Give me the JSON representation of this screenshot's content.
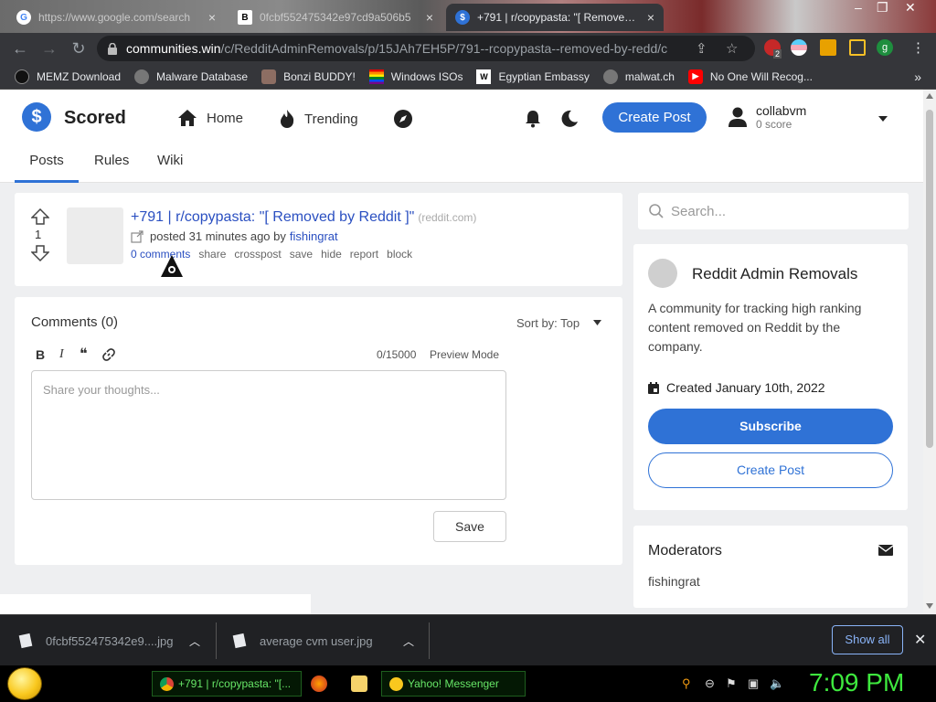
{
  "browser": {
    "tabs": [
      {
        "title": "https://www.google.com/search",
        "active": false
      },
      {
        "title": "0fcbf552475342e97cd9a506b5",
        "active": false
      },
      {
        "title": "+791 | r/copypasta: \"[ Removed by Reddit ]\"",
        "active": true
      }
    ],
    "url_host": "communities.win",
    "url_path": "/c/RedditAdminRemovals/p/15JAh7EH5P/791--rcopypasta--removed-by-redd/c",
    "extension_badge": "2",
    "profile_initial": "g",
    "bookmarks": [
      "MEMZ Download",
      "Malware Database",
      "Bonzi BUDDY!",
      "Windows ISOs",
      "Egyptian Embassy",
      "malwat.ch",
      "No One Will Recog..."
    ],
    "bookmarks_more": "»",
    "close_glyph": "✕",
    "tab_close_glyph": "×"
  },
  "site": {
    "brand": "Scored",
    "logo_glyph": "$",
    "nav": {
      "home": "Home",
      "trending": "Trending"
    },
    "create_post": "Create Post",
    "user": {
      "name": "collabvm",
      "score": "0 score"
    },
    "subnav": [
      "Posts",
      "Rules",
      "Wiki"
    ],
    "accent_color": "#2f72d6"
  },
  "post": {
    "votes": "1",
    "title": "+791 | r/copypasta: \"[ Removed by Reddit ]\"",
    "domain": "(reddit.com)",
    "meta_prefix": "posted 31 minutes ago by",
    "author": "fishingrat",
    "actions": [
      "0 comments",
      "share",
      "crosspost",
      "save",
      "hide",
      "report",
      "block"
    ]
  },
  "comments": {
    "title": "Comments (0)",
    "sort_label": "Sort by: Top",
    "format_buttons": {
      "bold": "B",
      "italic": "I",
      "quote": "❝"
    },
    "char_count": "0/15000",
    "preview_mode": "Preview Mode",
    "placeholder": "Share your thoughts...",
    "save": "Save"
  },
  "sidebar": {
    "search_placeholder": "Search...",
    "community_name": "Reddit Admin Removals",
    "description": "A community for tracking high ranking content removed on Reddit by the company.",
    "created": "Created January 10th, 2022",
    "subscribe": "Subscribe",
    "create_post": "Create Post",
    "moderators_title": "Moderators",
    "moderators": [
      "fishingrat"
    ]
  },
  "downloads": {
    "items": [
      "0fcbf552475342e9....jpg",
      "average cvm user.jpg"
    ],
    "show_all": "Show all",
    "close_glyph": "✕"
  },
  "taskbar": {
    "tasks": [
      "+791 | r/copypasta: \"[...",
      "Yahoo! Messenger"
    ],
    "clock": "7:09 PM"
  }
}
